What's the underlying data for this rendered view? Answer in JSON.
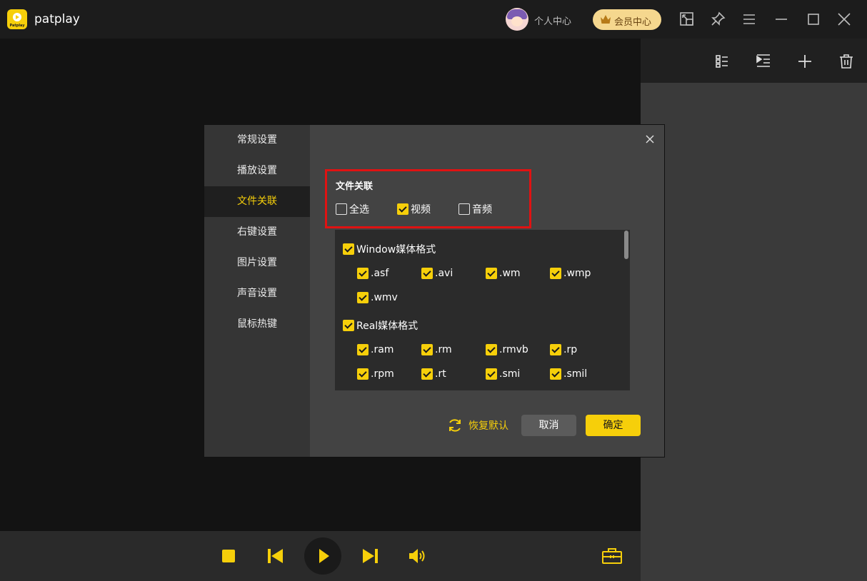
{
  "app": {
    "title": "patplay",
    "logo_sub": "Patplay",
    "user_center": "个人中心",
    "vip_center": "会员中心",
    "accent_color": "#f6cf0a"
  },
  "titlebar_icons": [
    "mini-mode-icon",
    "pin-icon",
    "menu-icon",
    "minimize-icon",
    "maximize-icon",
    "close-icon"
  ],
  "playlist_toolbar_icons": [
    "list-view-icon",
    "play-order-icon",
    "add-icon",
    "delete-icon"
  ],
  "dialog": {
    "nav": [
      {
        "label": "常规设置",
        "active": false
      },
      {
        "label": "播放设置",
        "active": false
      },
      {
        "label": "文件关联",
        "active": true
      },
      {
        "label": "右键设置",
        "active": false
      },
      {
        "label": "图片设置",
        "active": false
      },
      {
        "label": "声音设置",
        "active": false
      },
      {
        "label": "鼠标热键",
        "active": false
      }
    ],
    "section_title": "文件关联",
    "top_options": [
      {
        "label": "全选",
        "checked": false
      },
      {
        "label": "视频",
        "checked": true
      },
      {
        "label": "音频",
        "checked": false
      }
    ],
    "groups": [
      {
        "label": "Window媒体格式",
        "checked": true,
        "formats": [
          ".asf",
          ".avi",
          ".wm",
          ".wmp",
          ".wmv"
        ]
      },
      {
        "label": "Real媒体格式",
        "checked": true,
        "formats": [
          ".ram",
          ".rm",
          ".rmvb",
          ".rp",
          ".rpm",
          ".rt",
          ".smi",
          ".smil"
        ]
      }
    ],
    "restore_label": "恢复默认",
    "cancel_label": "取消",
    "ok_label": "确定"
  },
  "controls": [
    "stop-icon",
    "previous-icon",
    "play-icon",
    "next-icon",
    "volume-icon",
    "toolbox-icon"
  ]
}
